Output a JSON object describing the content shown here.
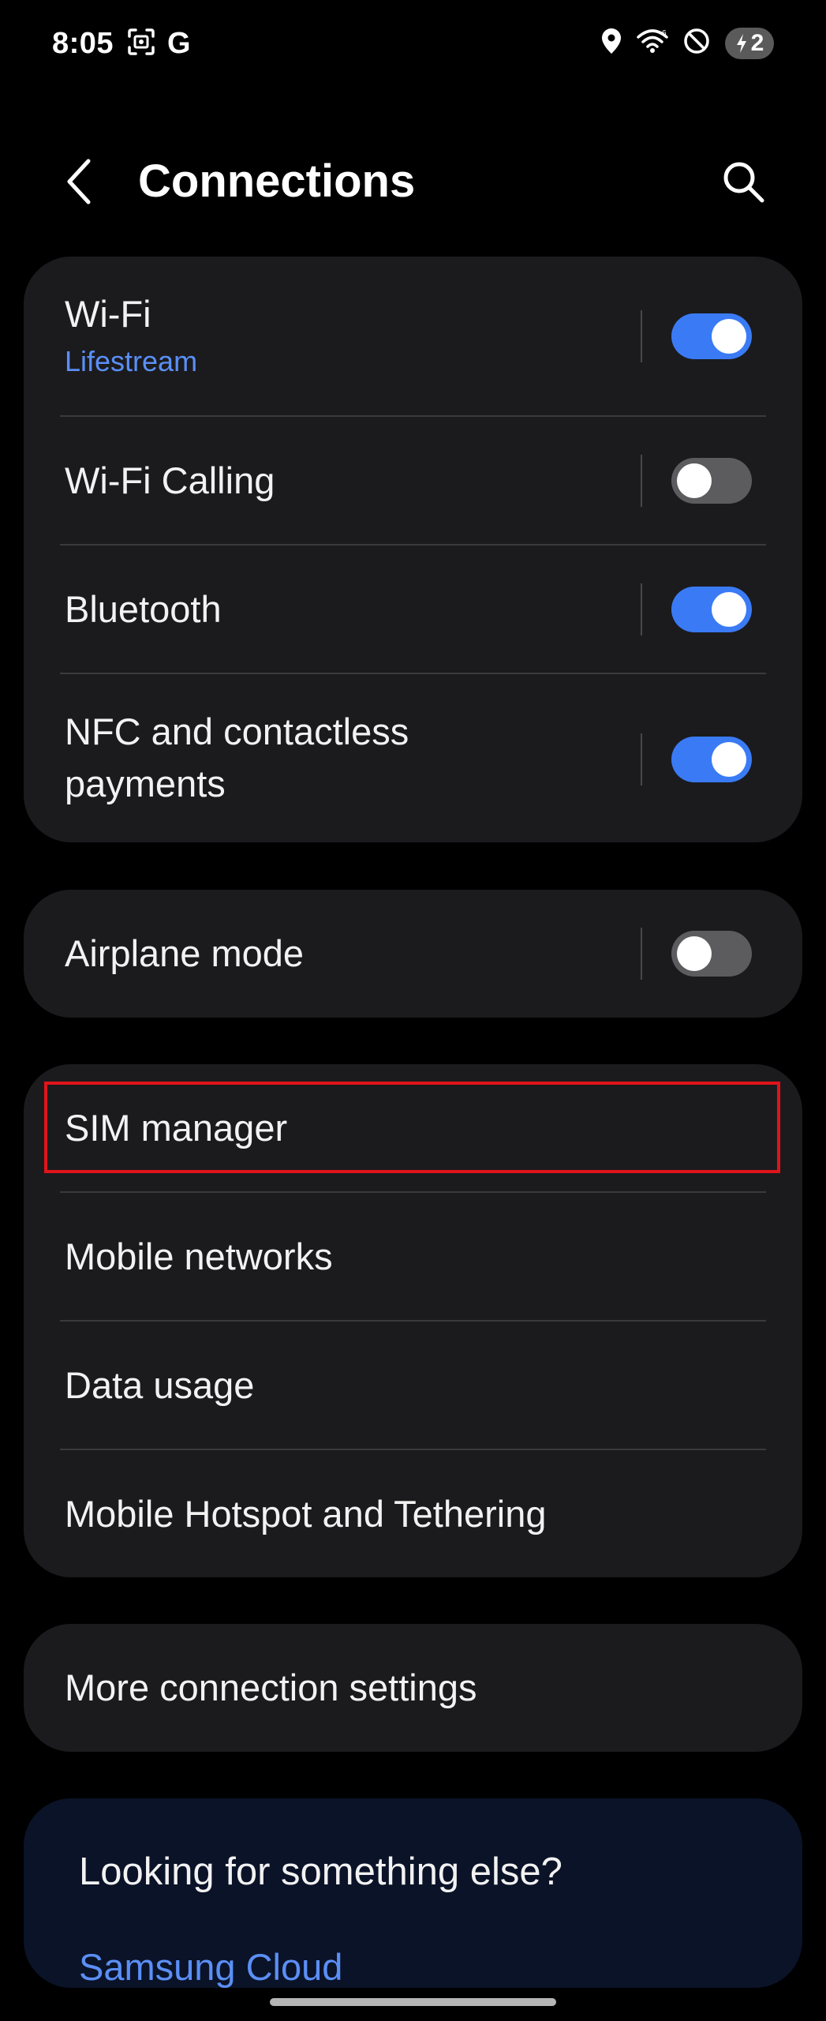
{
  "status_bar": {
    "time": "8:05",
    "g_label": "G",
    "battery_level": "2"
  },
  "header": {
    "title": "Connections"
  },
  "group_main": [
    {
      "label": "Wi-Fi",
      "sublabel": "Lifestream",
      "toggle_on": true
    },
    {
      "label": "Wi-Fi Calling",
      "toggle_on": false
    },
    {
      "label": "Bluetooth",
      "toggle_on": true
    },
    {
      "label_line1": "NFC and contactless",
      "label_line2": "payments",
      "toggle_on": true
    }
  ],
  "group_airplane": {
    "label": "Airplane mode",
    "toggle_on": false
  },
  "group_network": [
    {
      "label": "SIM manager"
    },
    {
      "label": "Mobile networks"
    },
    {
      "label": "Data usage"
    },
    {
      "label": "Mobile Hotspot and Tethering"
    }
  ],
  "group_more": {
    "label": "More connection settings"
  },
  "suggestions": {
    "title": "Looking for something else?",
    "link": "Samsung Cloud"
  },
  "colors": {
    "accent": "#3a7bf5",
    "link": "#5b8ff6",
    "card": "#1b1b1e",
    "highlight": "#e0141a"
  }
}
